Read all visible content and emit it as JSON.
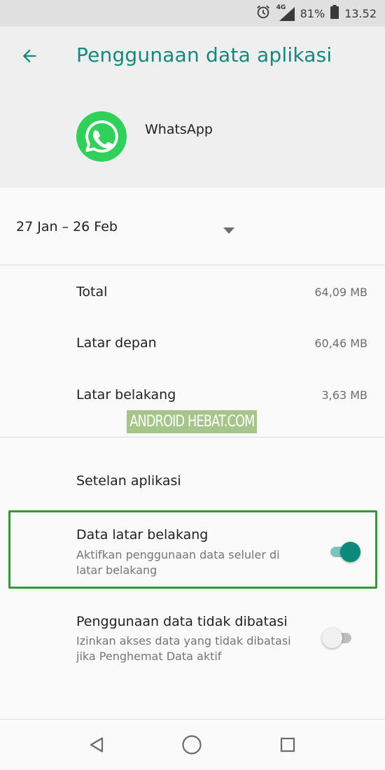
{
  "status_bar": {
    "network": "4G",
    "battery": "81%",
    "time": "13.52",
    "icons": [
      "alarm-icon",
      "signal-icon",
      "battery-icon"
    ]
  },
  "header": {
    "title": "Penggunaan data aplikasi",
    "back_icon": "arrow-back-icon"
  },
  "app": {
    "name": "WhatsApp",
    "icon": "whatsapp-logo-icon"
  },
  "cycle": {
    "label": "27 Jan – 26 Feb",
    "icon": "dropdown-arrow-icon"
  },
  "usage": [
    {
      "label": "Total",
      "value": "64,09 MB"
    },
    {
      "label": "Latar depan",
      "value": "60,46 MB"
    },
    {
      "label": "Latar belakang",
      "value": "3,63 MB"
    }
  ],
  "watermark": "ANDROID HEBAT.COM",
  "settings": {
    "header": "Setelan aplikasi",
    "background_data": {
      "title": "Data latar belakang",
      "summary": "Aktifkan penggunaan data seluler di latar belakang",
      "enabled": true
    },
    "unrestricted_data": {
      "title": "Penggunaan data tidak dibatasi",
      "summary": "Izinkan akses data yang tidak dibatasi jika Penghemat Data aktif",
      "enabled": false
    }
  },
  "navigation": [
    "back-nav-icon",
    "home-nav-icon",
    "recents-nav-icon"
  ],
  "colors": {
    "accent": "#13897b",
    "highlight_border": "#2f9a2f",
    "whatsapp_green": "#2fd15a"
  }
}
